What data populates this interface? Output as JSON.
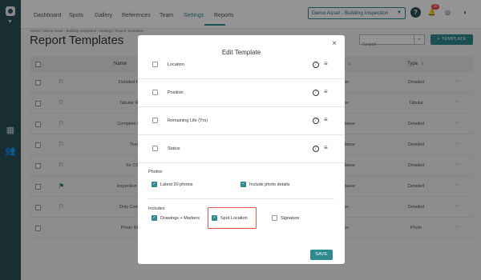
{
  "nav": {
    "items": [
      "Dashboard",
      "Spots",
      "Gallery",
      "References",
      "Team",
      "Settings",
      "Reports"
    ],
    "active": "Settings",
    "asset_select": "Demo Asset - Building Inspection",
    "help_icon": "?",
    "notification_count": "10"
  },
  "breadcrumb": "Assets / Demo Asset - Building Inspection / Settings / Report Templates",
  "page": {
    "title": "Report Templates",
    "search_placeholder": "Search",
    "add_button": "+ TEMPLATE"
  },
  "table": {
    "headers": {
      "name": "Name",
      "creator": "ator",
      "type": "Type"
    },
    "rows": [
      {
        "name": "Detailed Report",
        "creator": "n User",
        "type": "Detailed",
        "flag": "outline"
      },
      {
        "name": "Tabular Report",
        "creator": "n User",
        "type": "Tabular",
        "flag": "outline"
      },
      {
        "name": "Complete Report",
        "creator": "handawar",
        "type": "Detailed",
        "flag": "outline"
      },
      {
        "name": "Test",
        "creator": "handawar",
        "type": "Detailed",
        "flag": "outline"
      },
      {
        "name": "for CSV",
        "creator": "handawar",
        "type": "Detailed",
        "flag": "outline"
      },
      {
        "name": "Inspection Report",
        "creator": "handawar",
        "type": "Detailed",
        "flag": "filled"
      },
      {
        "name": "Only Comment",
        "creator": "n User",
        "type": "Detailed",
        "flag": "outline"
      },
      {
        "name": "Photo Report",
        "creator": "n User",
        "type": "Photo",
        "flag": "none"
      }
    ]
  },
  "modal": {
    "title": "Edit Template",
    "close_icon": "×",
    "fields": [
      "Location",
      "Position",
      "Remaining Life (Yrs)",
      "Status"
    ],
    "photos": {
      "title": "Photos",
      "options": [
        {
          "label": "Latest 20 photos",
          "checked": true
        },
        {
          "label": "Include photo details",
          "checked": true
        }
      ]
    },
    "includes": {
      "title": "Includes",
      "options": [
        {
          "label": "Drawings + Markers",
          "checked": true
        },
        {
          "label": "Spot Location",
          "checked": true
        },
        {
          "label": "Signature",
          "checked": false
        }
      ]
    },
    "save_button": "SAVE"
  },
  "colors": {
    "accent": "#2d8a8e",
    "sidebar": "#2a5058",
    "highlight": "#e05a4a",
    "badge": "#e94e4e"
  }
}
